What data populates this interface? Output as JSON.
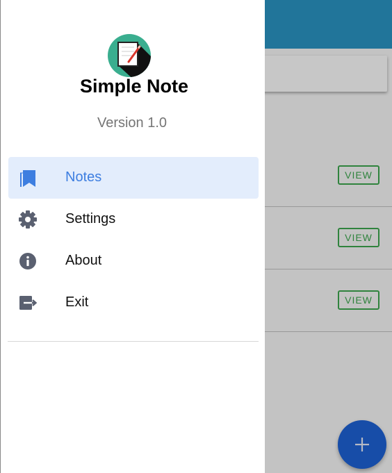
{
  "app": {
    "name": "Simple Note",
    "version": "Version 1.0"
  },
  "drawer": {
    "items": [
      {
        "label": "Notes",
        "icon": "bookmark-icon",
        "active": true
      },
      {
        "label": "Settings",
        "icon": "gear-icon",
        "active": false
      },
      {
        "label": "About",
        "icon": "info-icon",
        "active": false
      },
      {
        "label": "Exit",
        "icon": "exit-icon",
        "active": false
      }
    ]
  },
  "notes": {
    "view_labels": [
      "VIEW",
      "VIEW",
      "VIEW"
    ]
  },
  "fab": {
    "icon": "plus-icon"
  },
  "colors": {
    "app_bar": "#2b96c6",
    "active_item_bg": "#e3edfc",
    "active_item_text": "#3d7ee0",
    "view_button": "#3da84f",
    "fab": "#1e63d8",
    "logo_circle": "#3aae8f"
  }
}
